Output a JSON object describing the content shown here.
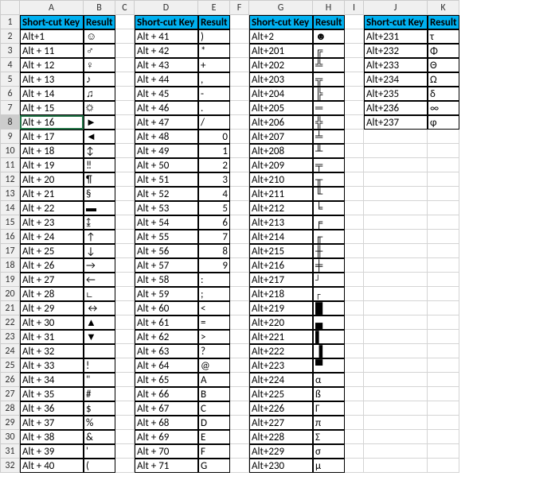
{
  "columns": [
    "A",
    "B",
    "C",
    "D",
    "E",
    "F",
    "G",
    "H",
    "I",
    "J",
    "K"
  ],
  "row_count": 32,
  "selected_cell": "A8",
  "tables": {
    "t1": {
      "header": [
        "Short-cut Key",
        "Result"
      ],
      "rows": [
        [
          "Alt+1",
          "☺"
        ],
        [
          "Alt + 11",
          "♂"
        ],
        [
          "Alt + 12",
          "♀"
        ],
        [
          "Alt + 13",
          "♪"
        ],
        [
          "Alt + 14",
          "♫"
        ],
        [
          "Alt + 15",
          "☼"
        ],
        [
          "Alt + 16",
          "►"
        ],
        [
          "Alt + 17",
          "◄"
        ],
        [
          "Alt + 18",
          "↕"
        ],
        [
          "Alt + 19",
          "‼"
        ],
        [
          "Alt + 20",
          "¶"
        ],
        [
          "Alt + 21",
          "§"
        ],
        [
          "Alt + 22",
          "▬"
        ],
        [
          "Alt + 23",
          "↨"
        ],
        [
          "Alt + 24",
          "↑"
        ],
        [
          "Alt + 25",
          "↓"
        ],
        [
          "Alt + 26",
          "→"
        ],
        [
          "Alt + 27",
          "←"
        ],
        [
          "Alt + 28",
          "∟"
        ],
        [
          "Alt + 29",
          "↔"
        ],
        [
          "Alt + 30",
          "▲"
        ],
        [
          "Alt + 31",
          "▼"
        ],
        [
          "Alt + 32",
          ""
        ],
        [
          "Alt + 33",
          "!"
        ],
        [
          "Alt + 34",
          "\""
        ],
        [
          "Alt + 35",
          "#"
        ],
        [
          "Alt + 36",
          "$"
        ],
        [
          "Alt + 37",
          "%"
        ],
        [
          "Alt + 38",
          "&"
        ],
        [
          "Alt + 39",
          "'"
        ],
        [
          "Alt + 40",
          "("
        ]
      ]
    },
    "t2": {
      "header": [
        "Short-cut Key",
        "Result"
      ],
      "rows": [
        [
          "Alt + 41",
          ")"
        ],
        [
          "Alt + 42",
          "*"
        ],
        [
          "Alt + 43",
          "+"
        ],
        [
          "Alt + 44",
          ","
        ],
        [
          "Alt + 45",
          "-"
        ],
        [
          "Alt + 46",
          "."
        ],
        [
          "Alt + 47",
          "/"
        ],
        [
          "Alt + 48",
          "0"
        ],
        [
          "Alt + 49",
          "1"
        ],
        [
          "Alt + 50",
          "2"
        ],
        [
          "Alt + 51",
          "3"
        ],
        [
          "Alt + 52",
          "4"
        ],
        [
          "Alt + 53",
          "5"
        ],
        [
          "Alt + 54",
          "6"
        ],
        [
          "Alt + 55",
          "7"
        ],
        [
          "Alt + 56",
          "8"
        ],
        [
          "Alt + 57",
          "9"
        ],
        [
          "Alt + 58",
          ":"
        ],
        [
          "Alt + 59",
          ";"
        ],
        [
          "Alt + 60",
          "<"
        ],
        [
          "Alt + 61",
          "="
        ],
        [
          "Alt + 62",
          ">"
        ],
        [
          "Alt + 63",
          "?"
        ],
        [
          "Alt + 64",
          "@"
        ],
        [
          "Alt + 65",
          "A"
        ],
        [
          "Alt + 66",
          "B"
        ],
        [
          "Alt + 67",
          "C"
        ],
        [
          "Alt + 68",
          "D"
        ],
        [
          "Alt + 69",
          "E"
        ],
        [
          "Alt + 70",
          "F"
        ],
        [
          "Alt + 71",
          "G"
        ]
      ],
      "numeric_rows": [
        7,
        8,
        9,
        10,
        11,
        12,
        13,
        14,
        15,
        16
      ]
    },
    "t3": {
      "header": [
        "Short-cut Key",
        "Result"
      ],
      "rows": [
        [
          "Alt+2",
          "☻"
        ],
        [
          "Alt+201",
          "╔"
        ],
        [
          "Alt+202",
          "╩"
        ],
        [
          "Alt+203",
          "╦"
        ],
        [
          "Alt+204",
          "╠"
        ],
        [
          "Alt+205",
          "═"
        ],
        [
          "Alt+206",
          "╬"
        ],
        [
          "Alt+207",
          "╧"
        ],
        [
          "Alt+208",
          "╨"
        ],
        [
          "Alt+209",
          "╤"
        ],
        [
          "Alt+210",
          "╥"
        ],
        [
          "Alt+211",
          "╙"
        ],
        [
          "Alt+212",
          "╘"
        ],
        [
          "Alt+213",
          "╒"
        ],
        [
          "Alt+214",
          "╓"
        ],
        [
          "Alt+215",
          "╫"
        ],
        [
          "Alt+216",
          "╪"
        ],
        [
          "Alt+217",
          "┘"
        ],
        [
          "Alt+218",
          "┌"
        ],
        [
          "Alt+219",
          "█"
        ],
        [
          "Alt+220",
          "▄"
        ],
        [
          "Alt+221",
          "▌"
        ],
        [
          "Alt+222",
          "▐"
        ],
        [
          "Alt+223",
          "▀"
        ],
        [
          "Alt+224",
          "α"
        ],
        [
          "Alt+225",
          "ß"
        ],
        [
          "Alt+226",
          "Γ"
        ],
        [
          "Alt+227",
          "π"
        ],
        [
          "Alt+228",
          "Σ"
        ],
        [
          "Alt+229",
          "σ"
        ],
        [
          "Alt+230",
          "µ"
        ]
      ]
    },
    "t4": {
      "header": [
        "Short-cut Key",
        "Result"
      ],
      "rows": [
        [
          "Alt+231",
          "τ"
        ],
        [
          "Alt+232",
          "Φ"
        ],
        [
          "Alt+233",
          "Θ"
        ],
        [
          "Alt+234",
          "Ω"
        ],
        [
          "Alt+235",
          "δ"
        ],
        [
          "Alt+236",
          "∞"
        ],
        [
          "Alt+237",
          "φ"
        ]
      ]
    }
  }
}
